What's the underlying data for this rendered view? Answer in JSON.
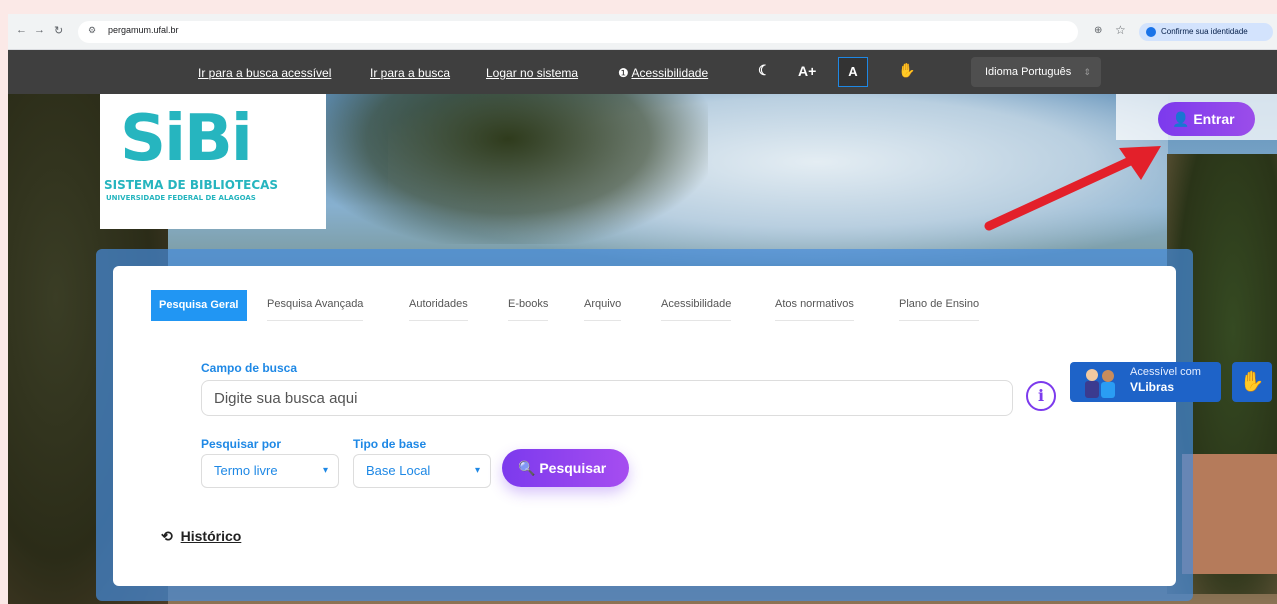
{
  "browser": {
    "url": "pergamum.ufal.br",
    "identity_label": "Confirme sua identidade"
  },
  "access_bar": {
    "links": [
      "Ir para a busca acessível",
      "Ir para a busca",
      "Logar no sistema",
      "Acessibilidade"
    ],
    "font_increase": "A+",
    "font_reset": "A",
    "language": "Idioma Português"
  },
  "logo": {
    "mark": "SiBi",
    "line1": "SISTEMA DE BIBLIOTECAS",
    "line2": "UNIVERSIDADE FEDERAL DE ALAGOAS"
  },
  "login_button": "Entrar",
  "tabs": [
    "Pesquisa Geral",
    "Pesquisa Avançada",
    "Autoridades",
    "E-books",
    "Arquivo",
    "Acessibilidade",
    "Atos normativos",
    "Plano de Ensino"
  ],
  "search": {
    "field_label": "Campo de busca",
    "placeholder": "Digite sua busca aqui",
    "search_by_label": "Pesquisar por",
    "search_by_value": "Termo livre",
    "base_label": "Tipo de base",
    "base_value": "Base Local",
    "submit": "Pesquisar"
  },
  "history": "Histórico",
  "vlibras": {
    "line1": "Acessível com",
    "line2": "VLibras"
  },
  "colors": {
    "accent_purple": "#7c3aed",
    "accent_blue": "#2196f3",
    "logo_teal": "#26b5bf",
    "arrow_red": "#e3202a"
  }
}
